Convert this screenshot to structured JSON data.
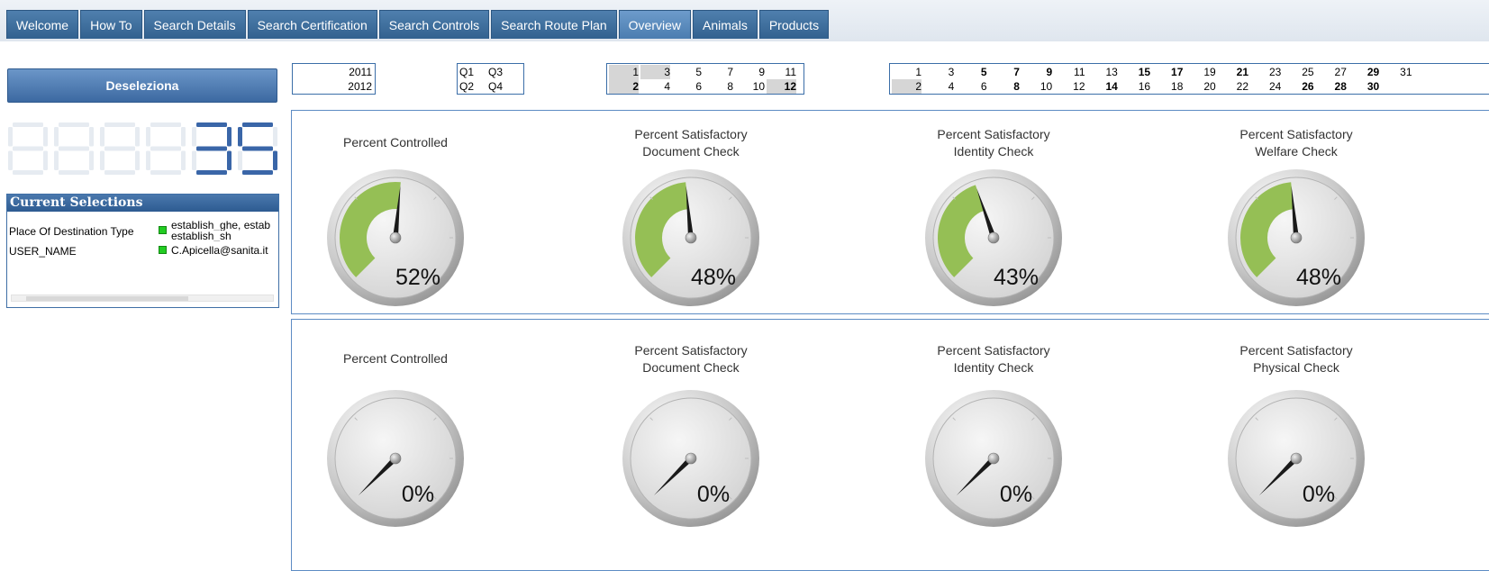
{
  "tabs": [
    {
      "label": "Welcome",
      "active": false
    },
    {
      "label": "How To",
      "active": false
    },
    {
      "label": "Search Details",
      "active": false
    },
    {
      "label": "Search Certification",
      "active": false
    },
    {
      "label": "Search Controls",
      "active": false
    },
    {
      "label": "Search Route Plan",
      "active": false
    },
    {
      "label": "Overview",
      "active": true
    },
    {
      "label": "Animals",
      "active": false
    },
    {
      "label": "Products",
      "active": false
    }
  ],
  "deselect_label": "Deseleziona",
  "counter": {
    "value": "35",
    "digits": 6
  },
  "current_selections": {
    "title": "Current Selections",
    "rows": [
      {
        "field": "Place Of Destination Type",
        "value_lines": [
          "establish_ghe, estab",
          "establish_sh"
        ]
      },
      {
        "field": "USER_NAME",
        "value_lines": [
          "C.Apicella@sanita.it"
        ]
      }
    ]
  },
  "filters": {
    "years": {
      "values": [
        "2011",
        "2012"
      ]
    },
    "quarters": {
      "values": [
        "Q1",
        "Q3",
        "Q2",
        "Q4"
      ]
    },
    "months": {
      "top": [
        "1",
        "3",
        "5",
        "7",
        "9",
        "11"
      ],
      "bottom": [
        "2",
        "4",
        "6",
        "8",
        "10",
        "12"
      ]
    },
    "days": {
      "top": [
        "1",
        "3",
        "5",
        "7",
        "9",
        "11",
        "13",
        "15",
        "17",
        "19",
        "21",
        "23",
        "25",
        "27",
        "29",
        "31"
      ],
      "bottom": [
        "2",
        "4",
        "6",
        "8",
        "10",
        "12",
        "14",
        "16",
        "18",
        "20",
        "22",
        "24",
        "26",
        "28",
        "30"
      ]
    }
  },
  "colors": {
    "tab": "#3e6d9d",
    "tab_active": "#5a8bbd",
    "panel_border": "#5d8cc4",
    "gauge_fill": "#95bf55",
    "selection_dot": "#22cc22"
  },
  "gauges_row1": [
    {
      "title_lines": [
        "Percent Controlled"
      ],
      "value": 52,
      "label": "52%"
    },
    {
      "title_lines": [
        "Percent Satisfactory",
        "Document Check"
      ],
      "value": 48,
      "label": "48%"
    },
    {
      "title_lines": [
        "Percent Satisfactory",
        "Identity Check"
      ],
      "value": 43,
      "label": "43%"
    },
    {
      "title_lines": [
        "Percent Satisfactory",
        "Welfare Check"
      ],
      "value": 48,
      "label": "48%"
    }
  ],
  "gauges_row2": [
    {
      "title_lines": [
        "Percent Controlled"
      ],
      "value": 0,
      "label": "0%"
    },
    {
      "title_lines": [
        "Percent Satisfactory",
        "Document Check"
      ],
      "value": 0,
      "label": "0%"
    },
    {
      "title_lines": [
        "Percent Satisfactory",
        "Identity Check"
      ],
      "value": 0,
      "label": "0%"
    },
    {
      "title_lines": [
        "Percent Satisfactory",
        "Physical Check"
      ],
      "value": 0,
      "label": "0%"
    }
  ]
}
